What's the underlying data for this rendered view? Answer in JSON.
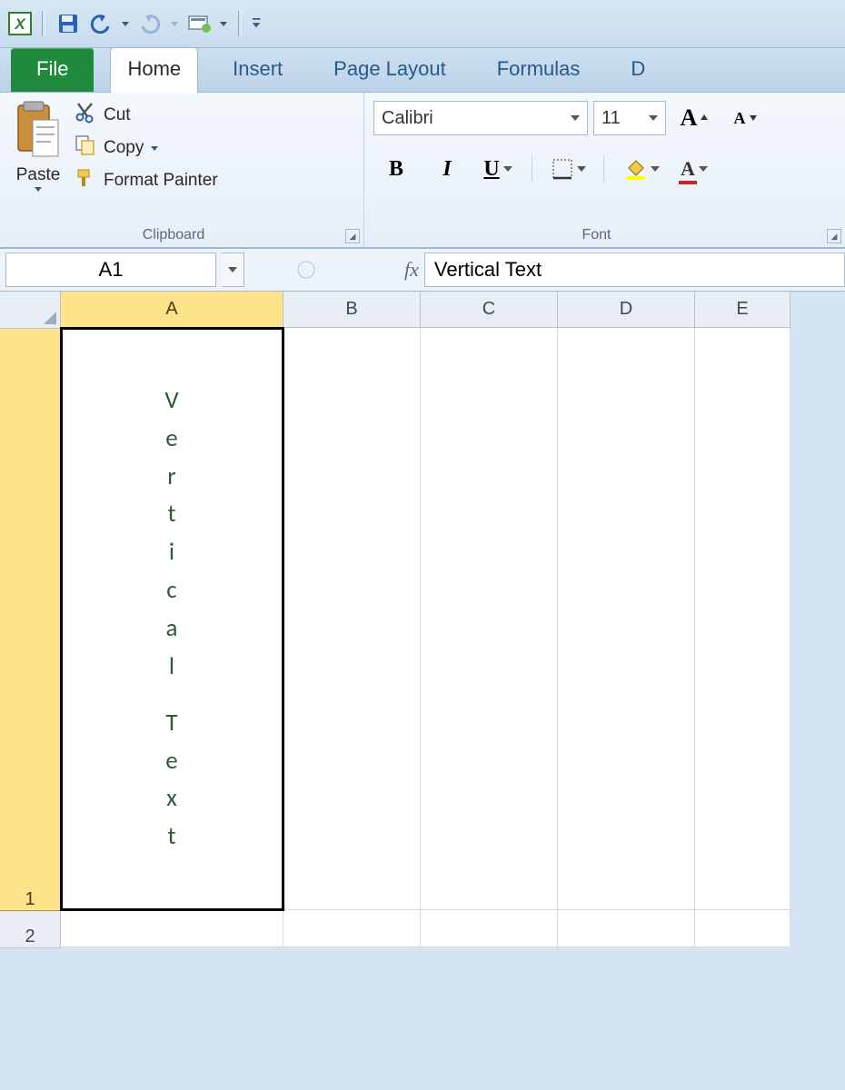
{
  "qat": {
    "save": "save-icon",
    "undo": "undo-icon",
    "redo": "redo-icon",
    "custom": "custom-icon"
  },
  "tabs": {
    "file": "File",
    "home": "Home",
    "insert": "Insert",
    "page_layout": "Page Layout",
    "formulas": "Formulas",
    "data_partial": "D"
  },
  "ribbon": {
    "clipboard": {
      "title": "Clipboard",
      "paste": "Paste",
      "cut": "Cut",
      "copy": "Copy",
      "format_painter": "Format Painter"
    },
    "font": {
      "title": "Font",
      "name": "Calibri",
      "size": "11",
      "bold": "B",
      "italic": "I",
      "underline": "U",
      "grow_a": "A",
      "shrink_a": "A"
    }
  },
  "formula_bar": {
    "name_box": "A1",
    "fx_label": "fx",
    "formula_value": "Vertical Text"
  },
  "grid": {
    "columns": [
      "A",
      "B",
      "C",
      "D",
      "E"
    ],
    "rows": [
      "1",
      "2"
    ],
    "selected_cell": "A1",
    "a1_vertical_chars": [
      "V",
      "e",
      "r",
      "t",
      "i",
      "c",
      "a",
      "l",
      " ",
      "T",
      "e",
      "x",
      "t"
    ]
  }
}
